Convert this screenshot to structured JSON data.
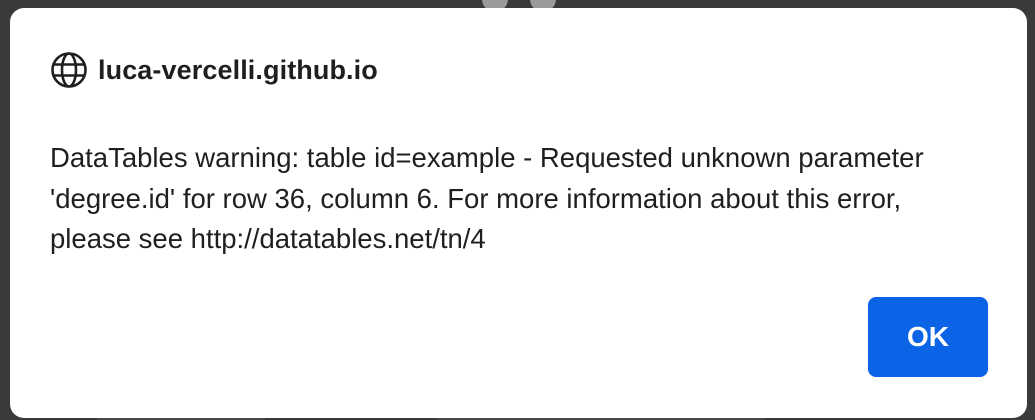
{
  "dialog": {
    "origin": "luca-vercelli.github.io",
    "origin_icon": "globe-icon",
    "message": "DataTables warning: table id=example - Requested unknown parameter 'degree.id' for row 36, column 6. For more information about this error, please see http://datatables.net/tn/4",
    "ok_label": "OK"
  },
  "colors": {
    "primary_button": "#0b63e5",
    "dialog_background": "#ffffff",
    "backdrop": "#3a3a3a",
    "text": "#1f1f1f"
  }
}
